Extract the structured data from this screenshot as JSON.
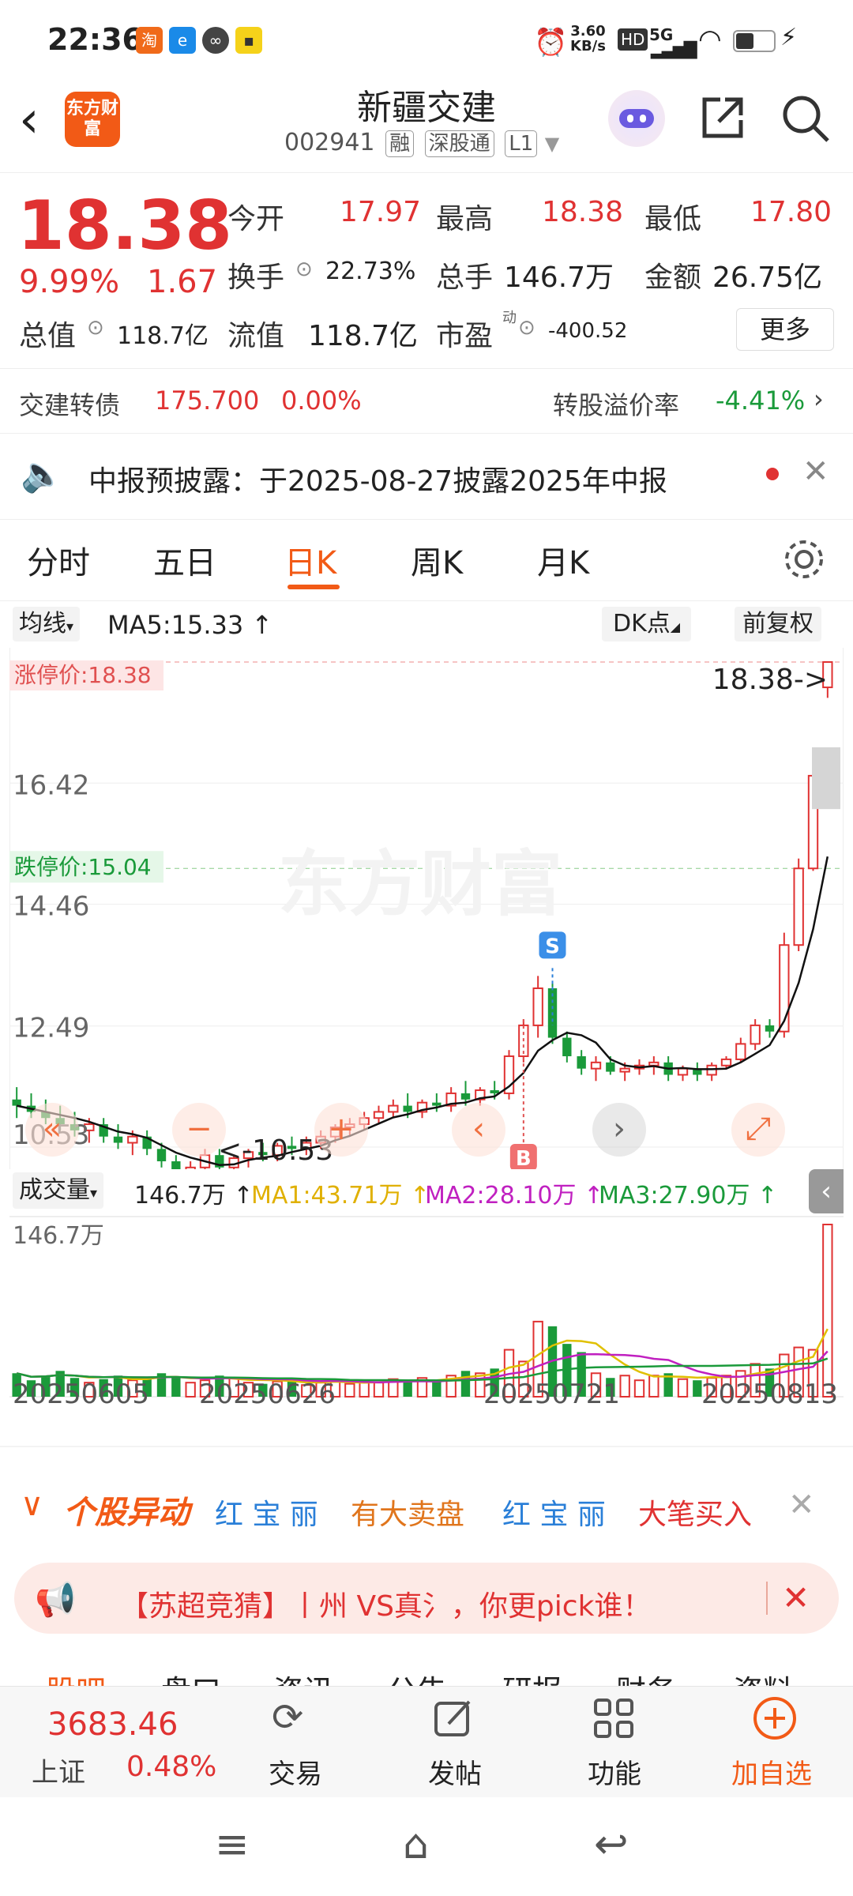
{
  "status_bar": {
    "time": "22:36",
    "net_speed_top": "3.60",
    "net_speed_bottom": "KB/s",
    "signal": "5G"
  },
  "header": {
    "title": "新疆交建",
    "code": "002941",
    "badges": [
      "融",
      "深股通",
      "L1"
    ],
    "logo_text": "东方财富"
  },
  "quote": {
    "price": "18.38",
    "change_pct": "9.99%",
    "change": "1.67",
    "open_label": "今开",
    "open": "17.97",
    "high_label": "最高",
    "high": "18.38",
    "low_label": "最低",
    "low": "17.80",
    "turnover_label": "换手",
    "turnover": "22.73%",
    "volume_label": "总手",
    "volume": "146.7万",
    "amount_label": "金额",
    "amount": "26.75亿",
    "mktcap_label": "总值",
    "mktcap": "118.7亿",
    "float_label": "流值",
    "float": "118.7亿",
    "pe_label": "市盈",
    "pe_sup": "动",
    "pe": "-400.52",
    "more": "更多"
  },
  "bond": {
    "name": "交建转债",
    "price": "175.700",
    "pct": "0.00%",
    "premium_label": "转股溢价率",
    "premium": "-4.41%"
  },
  "notice": {
    "text": "中报预披露：于2025-08-27披露2025年中报"
  },
  "tabs": [
    "分时",
    "五日",
    "日K",
    "周K",
    "月K",
    "更多"
  ],
  "active_tab": "日K",
  "chart_toolbar": {
    "ma_select": "均线",
    "ma5": "MA5:15.33 ↑",
    "dk": "DK点",
    "fq": "前复权"
  },
  "chart_data": {
    "type": "candlestick",
    "limit_up_label": "涨停价:18.38",
    "limit_down_label": "跌停价:15.04",
    "last_label": "18.38->",
    "low_label": "10.53",
    "y_ticks": [
      "16.42",
      "14.46",
      "12.49",
      "10.53"
    ],
    "ylim": [
      10.53,
      18.38
    ],
    "x_ticks": [
      "20250605",
      "20250626",
      "20250721",
      "20250813"
    ],
    "candles": [
      [
        11.3,
        11.5,
        11.0,
        11.2
      ],
      [
        11.2,
        11.4,
        11.0,
        11.1
      ],
      [
        11.1,
        11.3,
        10.9,
        11.0
      ],
      [
        11.0,
        11.2,
        10.8,
        10.9
      ],
      [
        10.9,
        11.1,
        10.7,
        10.8
      ],
      [
        10.8,
        11.0,
        10.6,
        10.9
      ],
      [
        10.9,
        11.0,
        10.6,
        10.7
      ],
      [
        10.7,
        10.9,
        10.5,
        10.6
      ],
      [
        10.6,
        10.8,
        10.4,
        10.7
      ],
      [
        10.7,
        10.8,
        10.4,
        10.5
      ],
      [
        10.5,
        10.6,
        10.2,
        10.3
      ],
      [
        10.3,
        10.4,
        10.0,
        10.1
      ],
      [
        10.1,
        10.3,
        9.9,
        10.2
      ],
      [
        10.2,
        10.5,
        10.1,
        10.4
      ],
      [
        10.4,
        10.5,
        10.1,
        10.2
      ],
      [
        10.2,
        10.4,
        10.1,
        10.35
      ],
      [
        10.35,
        10.5,
        10.2,
        10.45
      ],
      [
        10.45,
        10.6,
        10.3,
        10.4
      ],
      [
        10.4,
        10.6,
        10.3,
        10.55
      ],
      [
        10.55,
        10.7,
        10.4,
        10.5
      ],
      [
        10.5,
        10.7,
        10.4,
        10.6
      ],
      [
        10.6,
        10.8,
        10.5,
        10.7
      ],
      [
        10.7,
        10.9,
        10.6,
        10.85
      ],
      [
        10.85,
        11.0,
        10.7,
        10.9
      ],
      [
        10.9,
        11.1,
        10.8,
        11.0
      ],
      [
        11.0,
        11.2,
        10.9,
        11.1
      ],
      [
        11.1,
        11.3,
        11.0,
        11.2
      ],
      [
        11.2,
        11.4,
        11.0,
        11.1
      ],
      [
        11.1,
        11.3,
        11.0,
        11.25
      ],
      [
        11.25,
        11.4,
        11.1,
        11.2
      ],
      [
        11.2,
        11.5,
        11.1,
        11.4
      ],
      [
        11.4,
        11.6,
        11.2,
        11.3
      ],
      [
        11.3,
        11.5,
        11.2,
        11.45
      ],
      [
        11.45,
        11.6,
        11.3,
        11.4
      ],
      [
        11.4,
        12.1,
        11.3,
        12.0
      ],
      [
        12.0,
        12.6,
        11.9,
        12.5
      ],
      [
        12.5,
        13.3,
        12.3,
        13.1
      ],
      [
        13.1,
        13.2,
        12.2,
        12.3
      ],
      [
        12.3,
        12.4,
        11.9,
        12.0
      ],
      [
        12.0,
        12.1,
        11.7,
        11.8
      ],
      [
        11.8,
        12.0,
        11.6,
        11.9
      ],
      [
        11.9,
        12.0,
        11.7,
        11.75
      ],
      [
        11.75,
        11.9,
        11.6,
        11.8
      ],
      [
        11.8,
        11.95,
        11.7,
        11.85
      ],
      [
        11.85,
        12.0,
        11.7,
        11.9
      ],
      [
        11.9,
        12.0,
        11.6,
        11.7
      ],
      [
        11.7,
        11.85,
        11.6,
        11.8
      ],
      [
        11.8,
        11.9,
        11.6,
        11.7
      ],
      [
        11.7,
        11.9,
        11.6,
        11.85
      ],
      [
        11.85,
        12.0,
        11.8,
        11.95
      ],
      [
        11.95,
        12.3,
        11.9,
        12.2
      ],
      [
        12.2,
        12.6,
        12.1,
        12.5
      ],
      [
        12.5,
        12.6,
        12.3,
        12.4
      ],
      [
        12.4,
        14.0,
        12.3,
        13.8
      ],
      [
        13.8,
        15.2,
        13.7,
        15.04
      ],
      [
        15.04,
        16.6,
        15.0,
        16.54
      ],
      [
        17.97,
        18.38,
        17.8,
        18.38
      ]
    ],
    "volume_label": "成交量",
    "volume_value": "146.7万 ↑",
    "vol_ma1": "MA1:43.71万 ↑",
    "vol_ma2": "MA2:28.10万 ↑",
    "vol_ma3": "MA3:27.90万 ↑",
    "vol_max_label": "146.7万",
    "volumes": [
      20,
      14,
      18,
      22,
      16,
      12,
      15,
      18,
      14,
      16,
      20,
      17,
      12,
      14,
      18,
      16,
      12,
      11,
      13,
      15,
      10,
      12,
      14,
      11,
      13,
      12,
      15,
      14,
      16,
      13,
      18,
      22,
      20,
      24,
      40,
      30,
      64,
      60,
      45,
      38,
      20,
      16,
      18,
      14,
      18,
      20,
      15,
      14,
      16,
      18,
      22,
      28,
      24,
      36,
      42,
      40,
      146.7
    ],
    "vol_ylim": [
      0,
      146.7
    ],
    "markers": {
      "s": "S",
      "b": "B"
    }
  },
  "alert_bar": {
    "title": "个股异动",
    "items": [
      {
        "text": "红 宝 丽",
        "color": "#2a7fd8"
      },
      {
        "text": "有大卖盘",
        "color": "#e0751c"
      },
      {
        "text": "红 宝 丽",
        "color": "#2a7fd8"
      },
      {
        "text": "大笔买入",
        "color": "#e03232"
      }
    ]
  },
  "promo": {
    "text": "【苏超竞猜】丨州 VS真氵，你更pick谁！"
  },
  "sub_tabs": [
    "股吧",
    "盘口",
    "资讯",
    "公告",
    "研报",
    "财务",
    "资料"
  ],
  "bottom_nav": {
    "index_value": "3683.46",
    "index_name": "上证",
    "index_pct": "0.48%",
    "items": [
      "交易",
      "发帖",
      "功能",
      "加自选"
    ]
  },
  "colors": {
    "up": "#e03232",
    "down": "#1a9a3a",
    "accent": "#f25a16"
  }
}
